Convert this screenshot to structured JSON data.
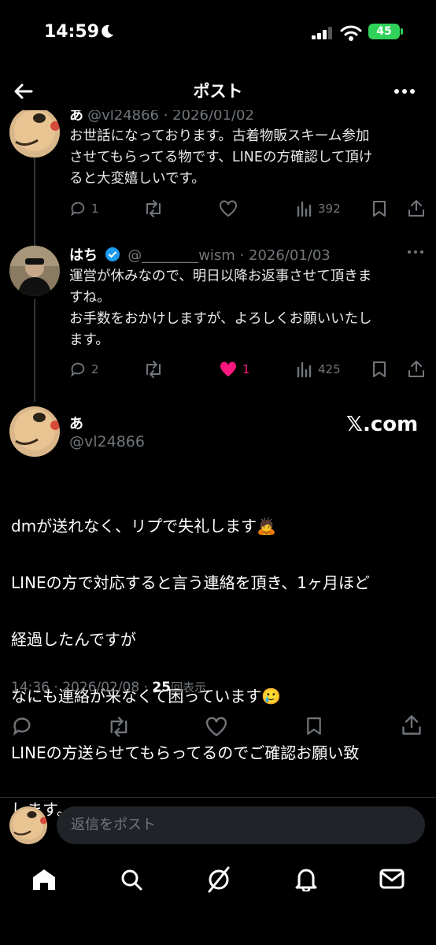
{
  "status": {
    "time": "14:59",
    "battery": "45"
  },
  "header": {
    "title": "ポスト"
  },
  "replies": [
    {
      "name": "あ",
      "handle": "@vl24866 · 2026/01/02",
      "text": "お世話になっております。古着物販スキーム参加\nさせてもらってる物です、LINEの方確認して頂け\nると大変嬉しいです。",
      "reply_count": "1",
      "like_count": "",
      "view_count": "392"
    },
    {
      "name": "はち",
      "handle": "@________wism · 2026/01/03",
      "text": "運営が休みなので、明日以降お返事させて頂きま\nすね。\nお手数をおかけしますが、よろしくお願いいたし\nます。",
      "reply_count": "2",
      "like_count": "1",
      "view_count": "425"
    }
  ],
  "main_post": {
    "name": "あ",
    "handle": "@vl24866",
    "badge": "𝕏.com",
    "text_lines": [
      "dmが送れなく、リプで失礼します🙇",
      "LINEの方で対応すると言う連絡を頂き、1ヶ月ほど",
      "経過したんですが",
      "なにも連絡が来なくて困っています🥲",
      "LINEの方送らせてもらってるのでご確認お願い致",
      "します。"
    ],
    "timestamp": "14:36 · 2026/02/08 · ",
    "views_number": "25",
    "views_label": "回表示"
  },
  "reply_input": {
    "placeholder": "返信をポスト"
  },
  "colors": {
    "like": "#f91880",
    "verified": "#1d9bf0",
    "battery": "#30d158"
  },
  "icons": {
    "nav": [
      "home-icon",
      "search-icon",
      "grok-icon",
      "bell-icon",
      "mail-icon"
    ],
    "actions": [
      "reply-icon",
      "repost-icon",
      "like-icon",
      "views-icon",
      "bookmark-icon",
      "share-icon"
    ]
  }
}
